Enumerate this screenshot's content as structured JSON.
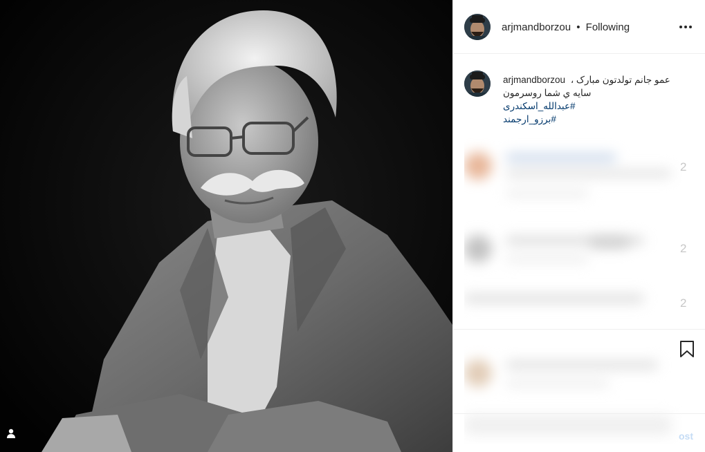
{
  "post": {
    "username": "arjmandborzou",
    "separator": "•",
    "follow_status": "Following",
    "more_icon": "more-options-icon",
    "caption": {
      "username": "arjmandborzou",
      "line1": "عمو جانم تولدتون مبارک ،",
      "line2": "سایه ي شما روسرمون",
      "hashtags": [
        "#عبدالله_اسکندری",
        "#برزو_ارجمند"
      ]
    },
    "partial_counts": [
      "2",
      "2",
      "2"
    ],
    "post_button_partial": "ost",
    "icons": {
      "tag": "user-tag-icon",
      "bookmark": "bookmark-icon"
    },
    "colors": {
      "hashtag": "#00376b",
      "text": "#262626",
      "border": "#efefef"
    }
  }
}
